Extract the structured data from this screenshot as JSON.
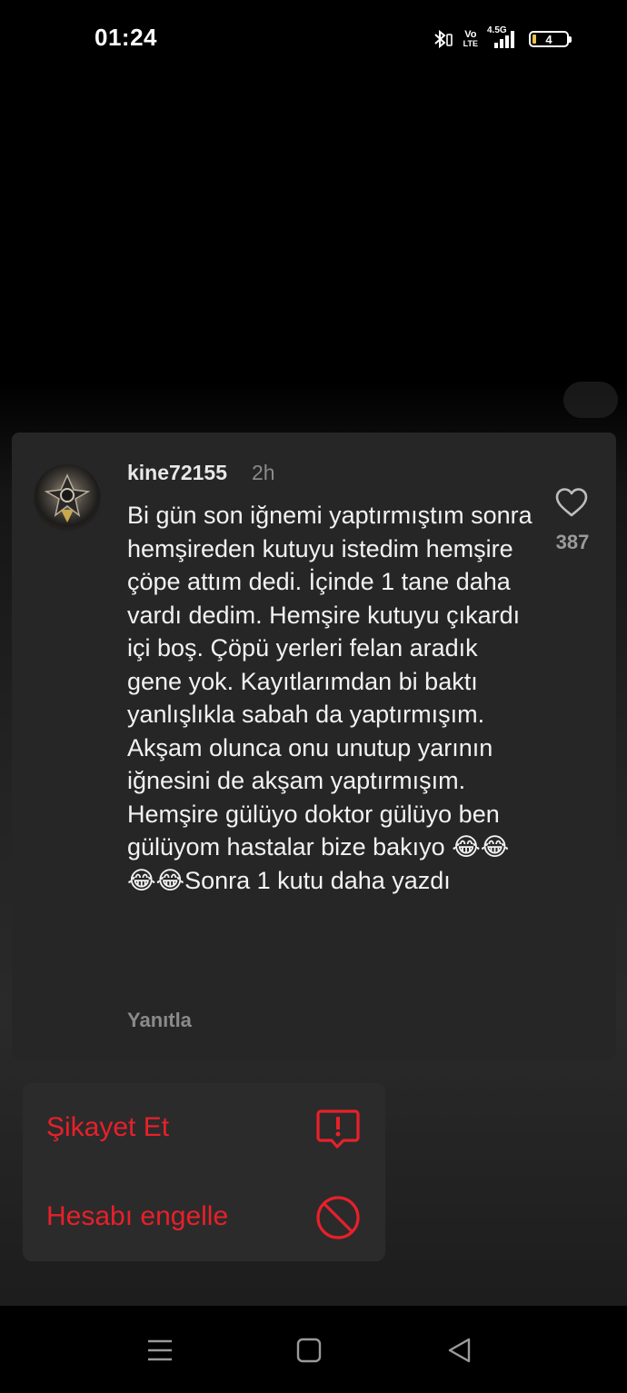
{
  "status_bar": {
    "time": "01:24",
    "network_small": "4.5G",
    "volte_top": "Vo",
    "volte_bottom": "LTE",
    "battery_level": "4",
    "icons": [
      "bluetooth-icon",
      "volte-icon",
      "signal-icon",
      "battery-icon"
    ]
  },
  "comment": {
    "username": "kine72155",
    "timestamp": "2h",
    "text": "Bi gün son iğnemi yaptırmıştım sonra hemşireden kutuyu istedim hemşire çöpe attım dedi. İçinde 1 tane daha vardı dedim. Hemşire kutuyu çıkardı içi boş. Çöpü yerleri felan aradık gene yok. Kayıtlarımdan bi baktı yanlışlıkla sabah da yaptırmışım. Akşam olunca onu unutup yarının iğnesini de akşam yaptırmışım. Hemşire gülüyo doktor gülüyo ben gülüyom hastalar bize bakıyo 😂😂😂😂Sonra 1 kutu daha yazdı",
    "like_count": "387",
    "reply_label": "Yanıtla"
  },
  "menu": {
    "items": [
      {
        "label": "Şikayet Et",
        "icon": "report-icon"
      },
      {
        "label": "Hesabı engelle",
        "icon": "block-icon"
      }
    ]
  },
  "colors": {
    "danger": "#e8202a",
    "card": "#262626",
    "menu": "#2b2b2b",
    "muted": "#8a8a8a"
  },
  "nav": [
    "menu-icon",
    "home-icon",
    "back-icon"
  ]
}
